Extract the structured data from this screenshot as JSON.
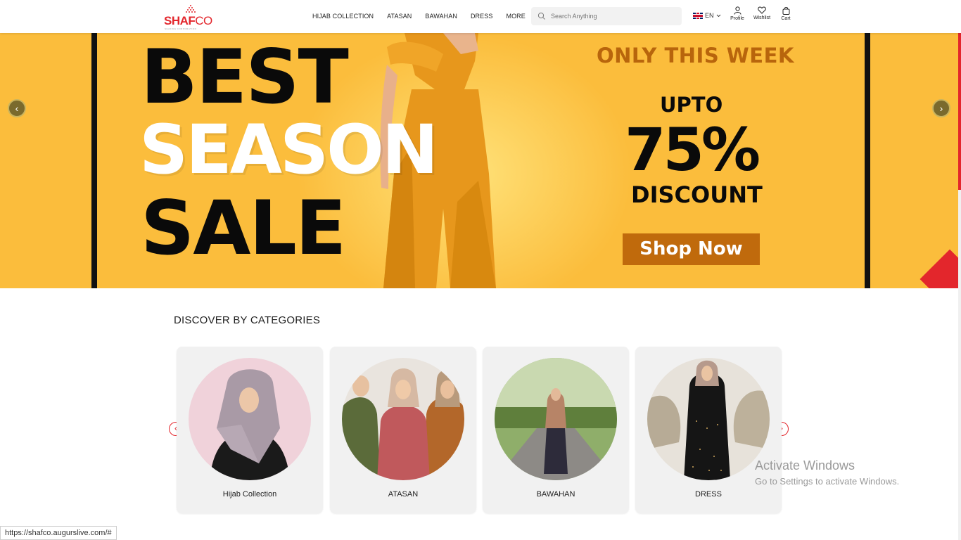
{
  "brand": {
    "name_a": "SHAF",
    "name_b": "CO",
    "tagline": "SHAFIRA CORPORATION",
    "color": "#e3262c"
  },
  "nav": [
    "HIJAB COLLECTION",
    "ATASAN",
    "BAWAHAN",
    "DRESS",
    "MORE"
  ],
  "search": {
    "placeholder": "Search Anything",
    "icon": "search-icon"
  },
  "language": {
    "code": "EN",
    "flag": "uk-flag-icon"
  },
  "header_icons": [
    {
      "label": "Profile",
      "icon": "user-icon"
    },
    {
      "label": "Wishlist",
      "icon": "heart-icon"
    },
    {
      "label": "Cart",
      "icon": "bag-icon"
    }
  ],
  "hero": {
    "line1": "BEST",
    "line2": "SEASON",
    "line3": "SALE",
    "promo": "ONLY THIS WEEK",
    "upto": "UPTO",
    "percent": "75%",
    "discount": "DISCOUNT",
    "cta": "Shop Now",
    "prev": "‹",
    "next": "›",
    "bg_color": "#fbbd3c"
  },
  "categories": {
    "title": "DISCOVER BY CATEGORIES",
    "prev": "‹",
    "next": "›",
    "items": [
      {
        "label": "Hijab Collection"
      },
      {
        "label": "ATASAN"
      },
      {
        "label": "BAWAHAN"
      },
      {
        "label": "DRESS"
      }
    ]
  },
  "watermark": {
    "line1": "Activate Windows",
    "line2": "Go to Settings to activate Windows."
  },
  "status_url": "https://shafco.augurslive.com/#"
}
